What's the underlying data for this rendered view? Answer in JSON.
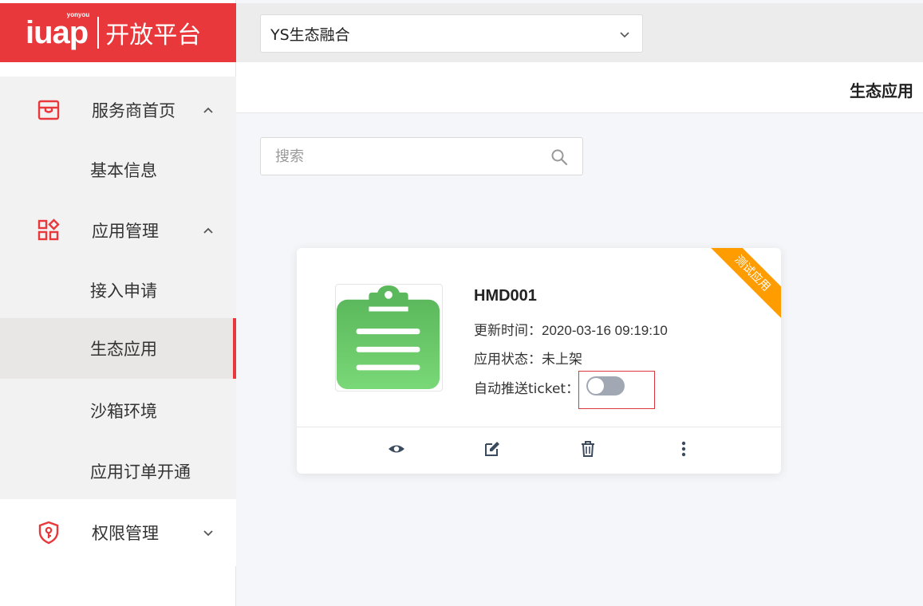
{
  "brand": {
    "logo_mark": "iuap",
    "logo_sup": "yonyou",
    "product": "开放平台",
    "accent": "#e8383b"
  },
  "org_select": {
    "value": "YS生态融合"
  },
  "header": {
    "title": "生态应用"
  },
  "sidebar": {
    "groups": [
      {
        "label": "服务商首页",
        "icon": "store-icon",
        "expanded": true
      },
      {
        "label": "应用管理",
        "icon": "apps-grid-icon",
        "expanded": true
      },
      {
        "label": "权限管理",
        "icon": "shield-key-icon",
        "expanded": false
      }
    ],
    "items": [
      {
        "label": "基本信息"
      },
      {
        "label": "接入申请"
      },
      {
        "label": "生态应用",
        "active": true
      },
      {
        "label": "沙箱环境"
      },
      {
        "label": "应用订单开通"
      }
    ]
  },
  "search": {
    "placeholder": "搜索"
  },
  "card": {
    "ribbon": "测试应用",
    "ribbon_color": "#ff9c00",
    "app_name": "HMD001",
    "updated_label": "更新时间：",
    "updated_value": "2020-03-16 09:19:10",
    "status_label": "应用状态：",
    "status_value": "未上架",
    "push_label": "自动推送ticket：",
    "push_enabled": false,
    "actions": [
      "view-icon",
      "edit-icon",
      "delete-icon",
      "more-icon"
    ]
  }
}
